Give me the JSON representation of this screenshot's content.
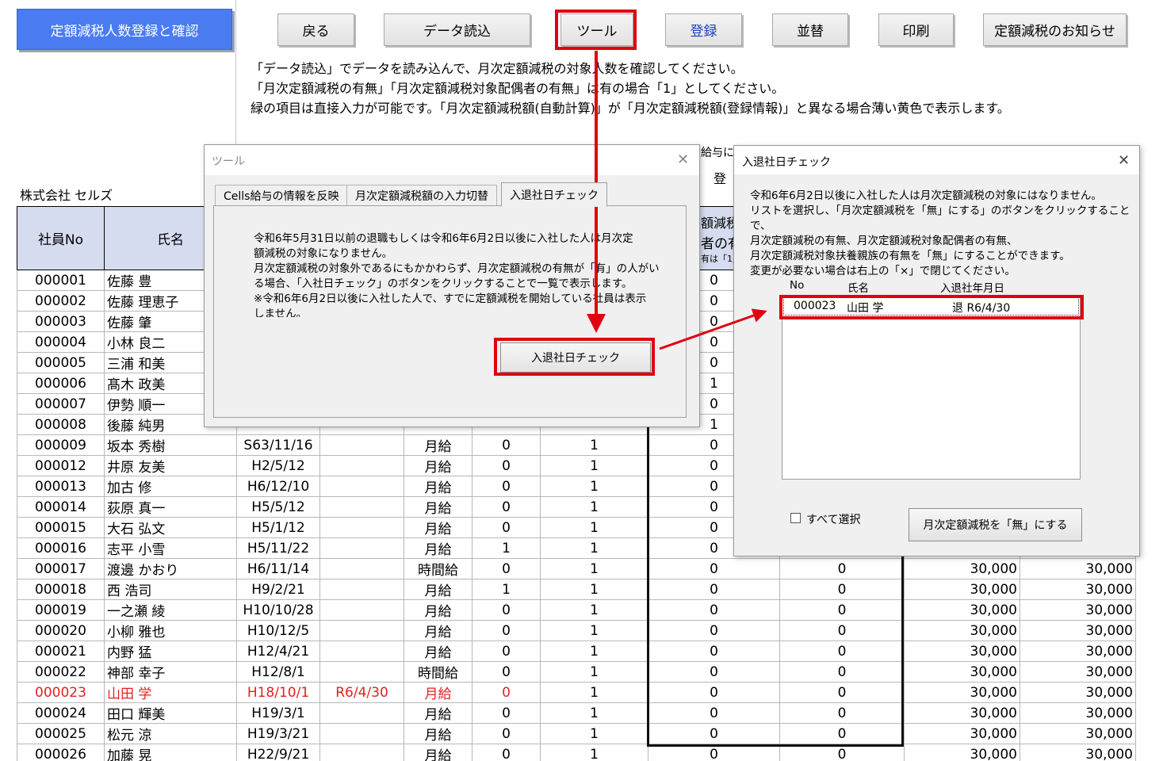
{
  "title_button": "定額減税人数登録と確認",
  "toolbar": {
    "back": "戻る",
    "load": "データ読込",
    "tool": "ツール",
    "register": "登録",
    "sort": "並替",
    "print": "印刷",
    "notice": "定額減税のお知らせ"
  },
  "notes": [
    "「データ読込」でデータを読み込んで、月次定額減税の対象人数を確認してください。",
    "「月次定額減税の有無」「月次定額減税対象配偶者の有無」は有の場合「1」としてください。",
    "緑の項目は直接入力が可能です。「月次定額減税額(自動計算)」が「月次定額減税額(登録情報)」と異なる場合薄い黄色で表示します。"
  ],
  "company": "株式会社 セルズ",
  "table": {
    "headers": [
      "社員No",
      "氏名",
      "",
      "",
      "",
      "",
      "",
      "",
      "",
      "",
      ""
    ],
    "rows": [
      [
        "000001",
        "佐藤 豊",
        "",
        "",
        "",
        "",
        "",
        "0",
        "",
        "",
        ""
      ],
      [
        "000002",
        "佐藤 理恵子",
        "",
        "",
        "",
        "",
        "",
        "0",
        "",
        "",
        ""
      ],
      [
        "000003",
        "佐藤 肇",
        "",
        "",
        "",
        "",
        "",
        "0",
        "",
        "",
        ""
      ],
      [
        "000004",
        "小林 良二",
        "",
        "",
        "",
        "",
        "",
        "0",
        "",
        "",
        ""
      ],
      [
        "000005",
        "三浦 和美",
        "",
        "",
        "",
        "",
        "",
        "0",
        "",
        "",
        ""
      ],
      [
        "000006",
        "髙木 政美",
        "",
        "",
        "",
        "",
        "",
        "1",
        "",
        "",
        ""
      ],
      [
        "000007",
        "伊勢 順一",
        "",
        "",
        "",
        "",
        "",
        "0",
        "",
        "",
        ""
      ],
      [
        "000008",
        "後藤 純男",
        "",
        "",
        "",
        "",
        "",
        "1",
        "",
        "",
        ""
      ],
      [
        "000009",
        "坂本 秀樹",
        "S63/11/16",
        "",
        "月給",
        "0",
        "1",
        "0",
        "",
        "",
        ""
      ],
      [
        "000012",
        "井原 友美",
        "H2/5/12",
        "",
        "月給",
        "0",
        "1",
        "0",
        "",
        "",
        ""
      ],
      [
        "000013",
        "加古 修",
        "H6/12/10",
        "",
        "月給",
        "0",
        "1",
        "0",
        "",
        "",
        ""
      ],
      [
        "000014",
        "荻原 真一",
        "H5/5/12",
        "",
        "月給",
        "0",
        "1",
        "0",
        "",
        "",
        ""
      ],
      [
        "000015",
        "大石 弘文",
        "H5/1/12",
        "",
        "月給",
        "0",
        "1",
        "0",
        "",
        "",
        ""
      ],
      [
        "000016",
        "志平 小雪",
        "H5/11/22",
        "",
        "月給",
        "1",
        "1",
        "0",
        "",
        "",
        ""
      ],
      [
        "000017",
        "渡邊 かおり",
        "H6/11/14",
        "",
        "時間給",
        "0",
        "1",
        "0",
        "0",
        "30,000",
        "30,000"
      ],
      [
        "000018",
        "西 浩司",
        "H9/2/21",
        "",
        "月給",
        "1",
        "1",
        "0",
        "0",
        "30,000",
        "30,000"
      ],
      [
        "000019",
        "一之瀬 綾",
        "H10/10/28",
        "",
        "月給",
        "0",
        "1",
        "0",
        "0",
        "30,000",
        "30,000"
      ],
      [
        "000020",
        "小柳 雅也",
        "H10/12/5",
        "",
        "月給",
        "0",
        "1",
        "0",
        "0",
        "30,000",
        "30,000"
      ],
      [
        "000021",
        "内野 猛",
        "H12/4/21",
        "",
        "月給",
        "0",
        "1",
        "0",
        "0",
        "30,000",
        "30,000"
      ],
      [
        "000022",
        "神部 幸子",
        "H12/8/1",
        "",
        "時間給",
        "0",
        "1",
        "0",
        "0",
        "30,000",
        "30,000"
      ],
      [
        "000023",
        "山田 学",
        "H18/10/1",
        "R6/4/30",
        "月給",
        "0",
        "1",
        "0",
        "0",
        "30,000",
        "30,000"
      ],
      [
        "000024",
        "田口 輝美",
        "H19/3/1",
        "",
        "月給",
        "0",
        "1",
        "0",
        "0",
        "30,000",
        "30,000"
      ],
      [
        "000025",
        "松元 涼",
        "H19/3/21",
        "",
        "月給",
        "0",
        "1",
        "0",
        "0",
        "30,000",
        "30,000"
      ],
      [
        "000026",
        "加藤 晃",
        "H22/9/21",
        "",
        "月給",
        "0",
        "1",
        "0",
        "0",
        "30,000",
        "30,000"
      ]
    ],
    "highlight_row_index": 20
  },
  "hidden_header_fragments": {
    "a": "給与に",
    "b": "登",
    "c": "額減税",
    "d": "者の有",
    "e": "有は「1」"
  },
  "tool_dialog": {
    "title": "ツール",
    "tabs": [
      "Cells給与の情報を反映",
      "月次定額減税額の入力切替",
      "入退社日チェック"
    ],
    "description": [
      "令和6年5月31日以前の退職もしくは令和6年6月2日以後に入社した人は月次定",
      "額減税の対象になりません。",
      "月次定額減税の対象外であるにもかかわらず、月次定額減税の有無が「有」の人がい",
      "る場合、「入社日チェック」のボタンをクリックすることで一覧で表示します。",
      "※令和6年6月2日以後に入社した人で、すでに定額減税を開始している社員は表示",
      "しません。"
    ],
    "check_button": "入退社日チェック"
  },
  "check_dialog": {
    "title": "入退社日チェック",
    "description": [
      "令和6年6月2日以後に入社した人は月次定額減税の対象にはなりません。",
      "リストを選択し、「月次定額減税を「無」にする」のボタンをクリックすることで、",
      "月次定額減税の有無、月次定額減税対象配偶者の有無、",
      "月次定額減税対象扶養親族の有無を「無」にすることができます。",
      "変更が必要ない場合は右上の「×」で閉じてください。"
    ],
    "list_headers": {
      "no": "No",
      "name": "氏名",
      "date": "入退社年月日"
    },
    "list_items": [
      {
        "no": "000023",
        "name": "山田 学",
        "date": "退 R6/4/30"
      }
    ],
    "select_all": "すべて選択",
    "set_none_button": "月次定額減税を「無」にする"
  },
  "colors": {
    "title_button": "#4a7bf0",
    "highlight_red": "#e0000f",
    "header_bg": "#d6dcef",
    "row_red": "#e32020"
  }
}
